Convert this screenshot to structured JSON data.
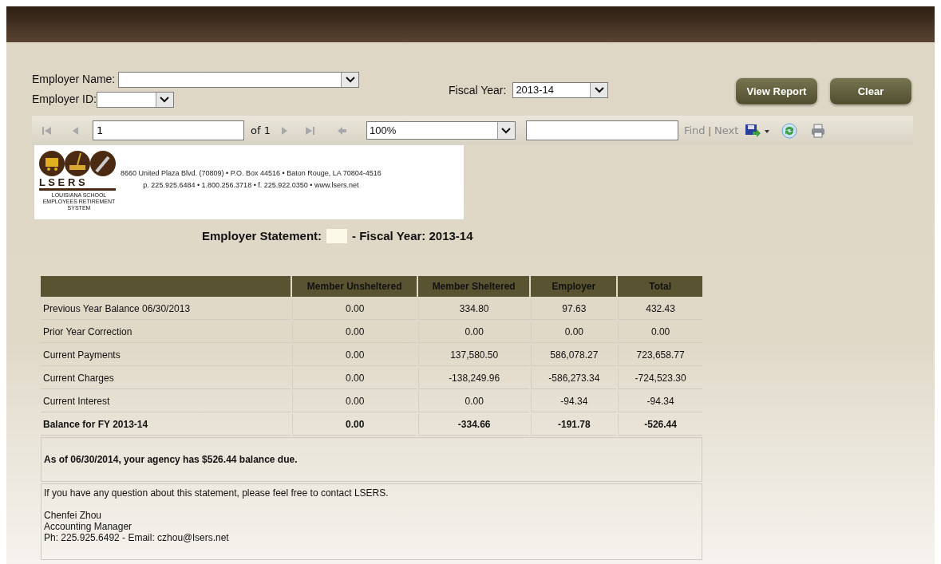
{
  "form": {
    "employer_name_label": "Employer Name:",
    "employer_id_label": "Employer ID:",
    "fiscal_year_label": "Fiscal Year:",
    "fiscal_year": "2013-14",
    "buttons": [
      "View Report",
      "Clear"
    ]
  },
  "toolbar": {
    "nav_first": {
      "disabled": true
    },
    "nav_prev": {
      "disabled": true
    },
    "page": "1",
    "page_of": "of 1",
    "nav_next": {
      "disabled": true
    },
    "nav_last": {
      "disabled": true
    },
    "nav_back": {
      "disabled": true
    },
    "zoom": "100%",
    "find_link": "Find",
    "separator": "|",
    "next_link": "Next"
  },
  "letterhead": {
    "logo_letters": "L S E R S",
    "logo_caption": "LOUISIANA SCHOOL EMPLOYEES RETIREMENT SYSTEM",
    "address_line_1": "8660 United Plaza Blvd. (70809) • P.O. Box 44516 • Baton Rouge, LA 70804-4516",
    "address_line_2": "p. 225.925.6484 • 1.800.256.3718 • f. 225.922.0350 • www.lsers.net"
  },
  "statement_title": {
    "prefix": "Employer Statement:",
    "suffix": "- Fiscal Year: 2013-14"
  },
  "table": {
    "columns": [
      "",
      "Member Unsheltered",
      "Member Sheltered",
      "Employer",
      "Total"
    ],
    "rows": [
      {
        "bold": false,
        "cells": [
          "Previous Year Balance 06/30/2013",
          "0.00",
          "334.80",
          "97.63",
          "432.43"
        ]
      },
      {
        "bold": false,
        "cells": [
          "Prior Year Correction",
          "0.00",
          "0.00",
          "0.00",
          "0.00"
        ]
      },
      {
        "bold": false,
        "cells": [
          "Current Payments",
          "0.00",
          "137,580.50",
          "586,078.27",
          "723,658.77"
        ]
      },
      {
        "bold": false,
        "cells": [
          "Current Charges",
          "0.00",
          "-138,249.96",
          "-586,273.34",
          "-724,523.30"
        ]
      },
      {
        "bold": false,
        "cells": [
          "Current Interest",
          "0.00",
          "0.00",
          "-94.34",
          "-94.34"
        ]
      },
      {
        "bold": true,
        "cells": [
          "Balance for FY 2013-14",
          "0.00",
          "-334.66",
          "-191.78",
          "-526.44"
        ]
      }
    ],
    "balance_note": "As of 06/30/2014, your agency has $526.44 balance due.",
    "contact_question": "If you have any question about this statement, please feel free to contact LSERS.",
    "contact": [
      "Chenfei Zhou",
      "Accounting Manager",
      "Ph: 225.925.6492 - Email: czhou@lsers.net"
    ]
  }
}
